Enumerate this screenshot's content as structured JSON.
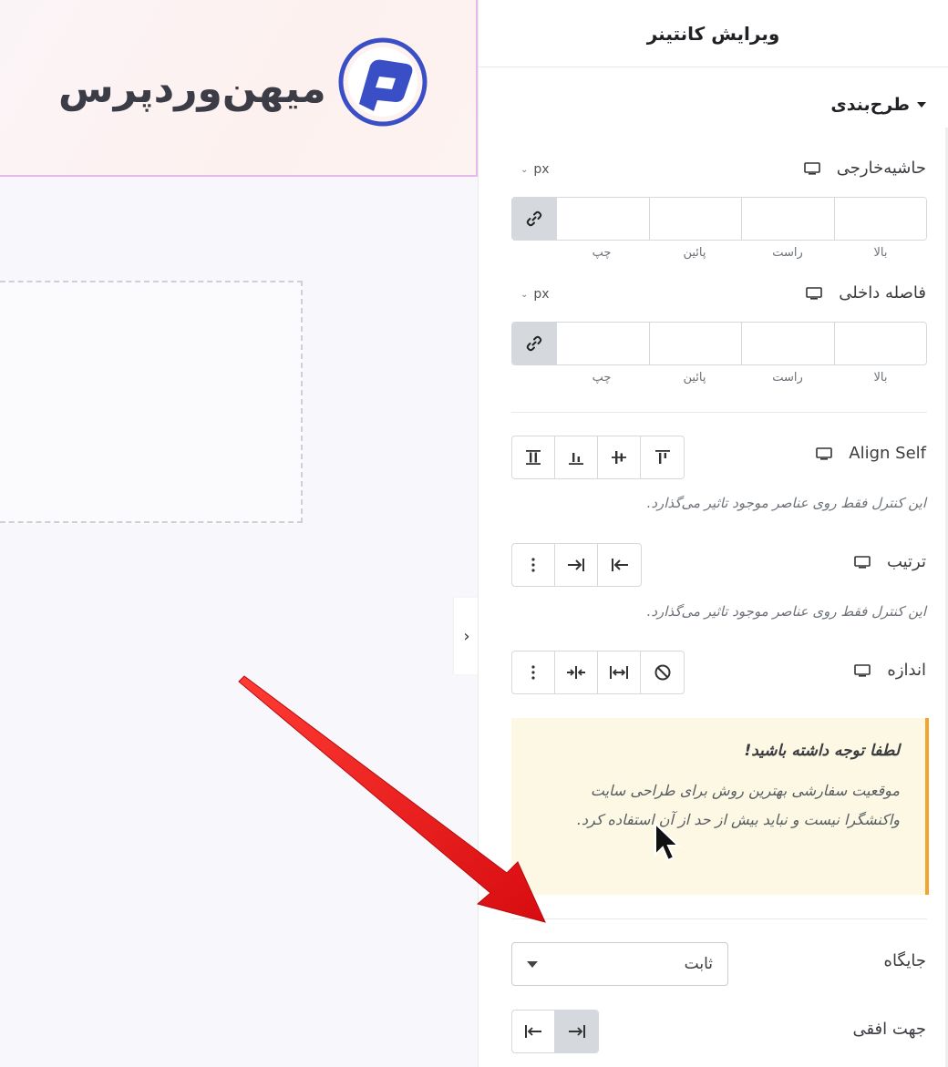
{
  "canvas": {
    "logo_text": "میهن‌وردپرس"
  },
  "panel": {
    "title": "ویرایش کانتینر",
    "section_layout": "طرح‌بندی",
    "margin": {
      "label": "حاشیه‌خارجی",
      "unit": "px",
      "sides": [
        "بالا",
        "راست",
        "پائین",
        "چپ"
      ]
    },
    "padding": {
      "label": "فاصله داخلی",
      "unit": "px",
      "sides": [
        "بالا",
        "راست",
        "پائین",
        "چپ"
      ]
    },
    "align_self": {
      "label": "Align Self",
      "help": "این کنترل فقط روی عناصر موجود تاثیر می‌گذارد."
    },
    "order": {
      "label": "ترتیب",
      "help": "این کنترل فقط روی عناصر موجود تاثیر می‌گذارد."
    },
    "size": {
      "label": "اندازه"
    },
    "notice": {
      "title": "لطفا توجه داشته باشید!",
      "body": "موقعیت سفارشی بهترین روش برای طراحی سایت واکنشگرا نیست و نباید بیش از حد از آن استفاده کرد."
    },
    "position": {
      "label": "جایگاه",
      "value": "ثابت"
    },
    "horizontal_orientation": {
      "label": "جهت افقی"
    }
  },
  "colors": {
    "accent_notice": "#f0a52f",
    "logo_blue": "#3a4fc6",
    "arrow_red": "#e8141b"
  }
}
